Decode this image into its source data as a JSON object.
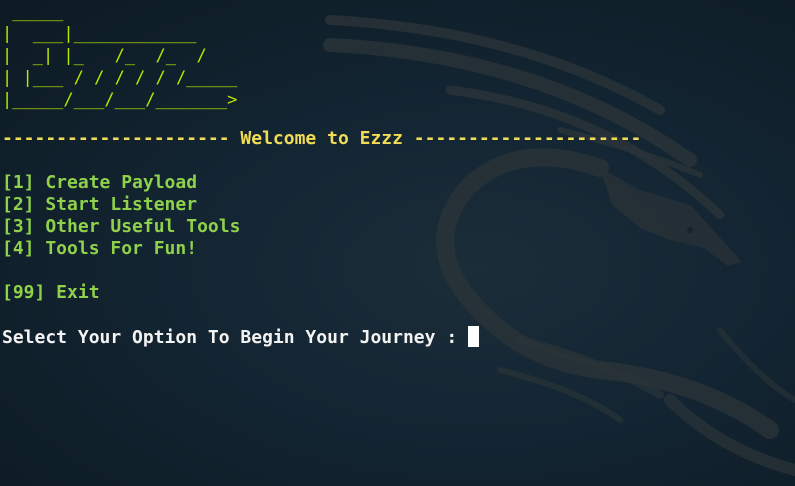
{
  "logo": {
    "lines": [
      " _____",
      "|  ___|____________",
      "|  _| |_   /_  /_  /",
      "| |___ / / / / / /_____",
      "|_____/___/___/_______>"
    ]
  },
  "welcome_text": "--------------------- Welcome to Ezzz ---------------------",
  "menu": {
    "items": [
      {
        "label": "[1] Create Payload"
      },
      {
        "label": "[2] Start Listener"
      },
      {
        "label": "[3] Other Useful Tools"
      },
      {
        "label": "[4] Tools For Fun!"
      }
    ],
    "exit_label": "[99] Exit"
  },
  "prompt": {
    "text": "Select Your Option To Begin Your Journey : "
  },
  "colors": {
    "logo": "#b8e600",
    "welcome": "#f2dc55",
    "menu": "#8fd14a",
    "prompt": "#f3f3f3",
    "background": "#132532"
  },
  "icons": {
    "background": "kali-dragon-icon"
  }
}
